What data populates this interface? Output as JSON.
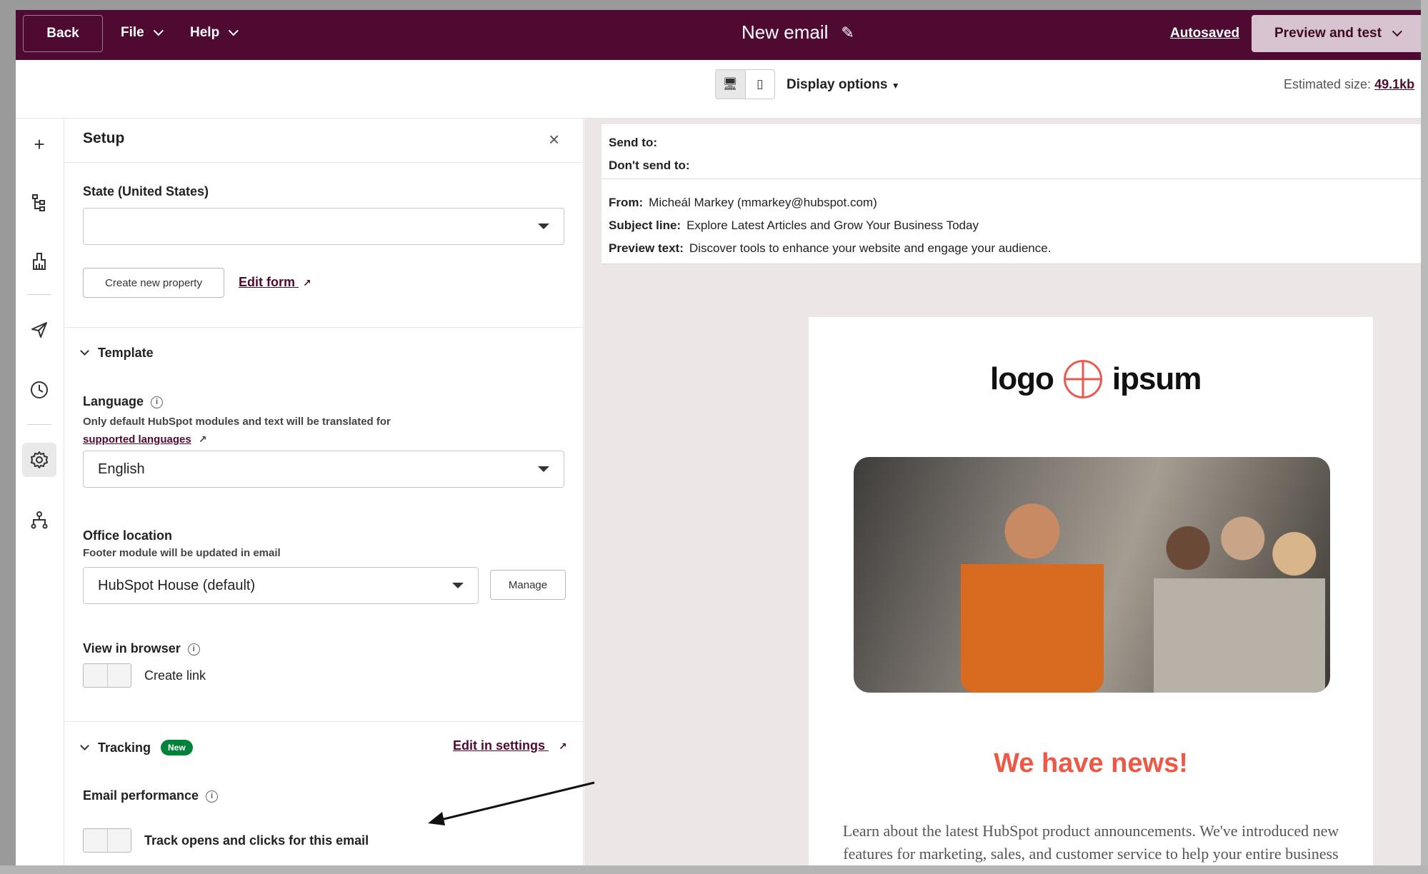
{
  "header": {
    "back_label": "Back",
    "file_label": "File",
    "help_label": "Help",
    "title": "New email",
    "autosaved_label": "Autosaved",
    "preview_label": "Preview and test"
  },
  "subbar": {
    "display_options_label": "Display options",
    "estimated_size_label": "Estimated size:",
    "estimated_size_value": "49.1kb"
  },
  "rail": {
    "icons": [
      "plus-icon",
      "structure-icon",
      "brush-icon",
      "send-icon",
      "clock-icon",
      "gear-icon",
      "hierarchy-icon"
    ],
    "active": "gear-icon"
  },
  "setup": {
    "title": "Setup",
    "state_label": "State (United States)",
    "state_value": "",
    "create_property_label": "Create new property",
    "edit_form_label": "Edit form",
    "template_section": "Template",
    "language_label": "Language",
    "language_help": "Only default HubSpot modules and text will be translated for",
    "language_help_link": "supported languages",
    "language_value": "English",
    "office_label": "Office location",
    "office_help": "Footer module will be updated in email",
    "office_value": "HubSpot House (default)",
    "manage_label": "Manage",
    "view_browser_label": "View in browser",
    "create_link_label": "Create link",
    "tracking_section": "Tracking",
    "new_badge": "New",
    "edit_settings_label": "Edit in settings",
    "email_performance_label": "Email performance",
    "track_label": "Track opens and clicks for this email"
  },
  "email": {
    "send_to_label": "Send to:",
    "dont_send_label": "Don't send to:",
    "from_label": "From:",
    "from_value": "Micheál Markey (mmarkey@hubspot.com)",
    "subject_label": "Subject line:",
    "subject_value": "Explore Latest Articles and Grow Your Business Today",
    "preview_text_label": "Preview text:",
    "preview_text_value": "Discover tools to enhance your website and engage your audience.",
    "logo_left": "logo",
    "logo_right": "ipsum",
    "headline": "We have news!",
    "body": "Learn about the latest HubSpot product announcements. We've introduced new features for marketing, sales, and customer service to help your entire business grow better."
  },
  "colors": {
    "header_bg": "#4f0a31",
    "preview_button_bg": "#d8c3d0",
    "headline_color": "#ec5a47",
    "new_badge_bg": "#00823b"
  }
}
